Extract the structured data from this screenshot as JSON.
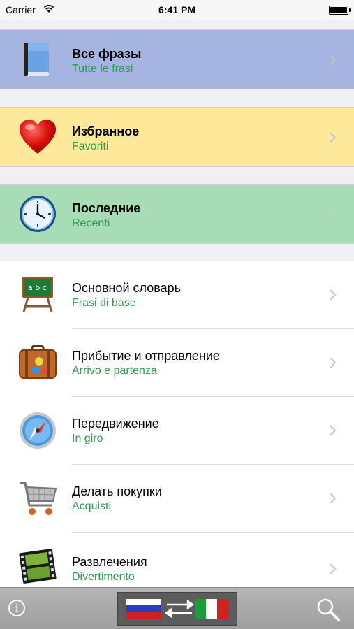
{
  "status_bar": {
    "carrier": "Carrier",
    "time": "6:41 PM"
  },
  "sections": [
    {
      "title": "Все фразы",
      "subtitle": "Tutte le frasi",
      "icon": "book-icon",
      "bg": "#a6b4e2"
    },
    {
      "title": "Избранное",
      "subtitle": "Favoriti",
      "icon": "heart-icon",
      "bg": "#fee99a"
    },
    {
      "title": "Последние",
      "subtitle": "Recenti",
      "icon": "clock-icon",
      "bg": "#a8dcb7"
    }
  ],
  "categories": [
    {
      "title": "Основной словарь",
      "subtitle": "Frasi di base",
      "icon": "chalkboard-icon"
    },
    {
      "title": "Прибытие и отправление",
      "subtitle": "Arrivo e partenza",
      "icon": "suitcase-icon"
    },
    {
      "title": "Передвижение",
      "subtitle": "In giro",
      "icon": "compass-icon"
    },
    {
      "title": "Делать покупки",
      "subtitle": "Acquisti",
      "icon": "shopping-cart-icon"
    },
    {
      "title": "Развлечения",
      "subtitle": "Divertimento",
      "icon": "film-icon"
    }
  ],
  "toolbar": {
    "info_glyph": "i",
    "from_language": "russian-flag-icon",
    "to_language": "italian-flag-icon"
  },
  "colors": {
    "subtitle": "#2e9a4e",
    "toolbar": "#a8a8a8"
  }
}
